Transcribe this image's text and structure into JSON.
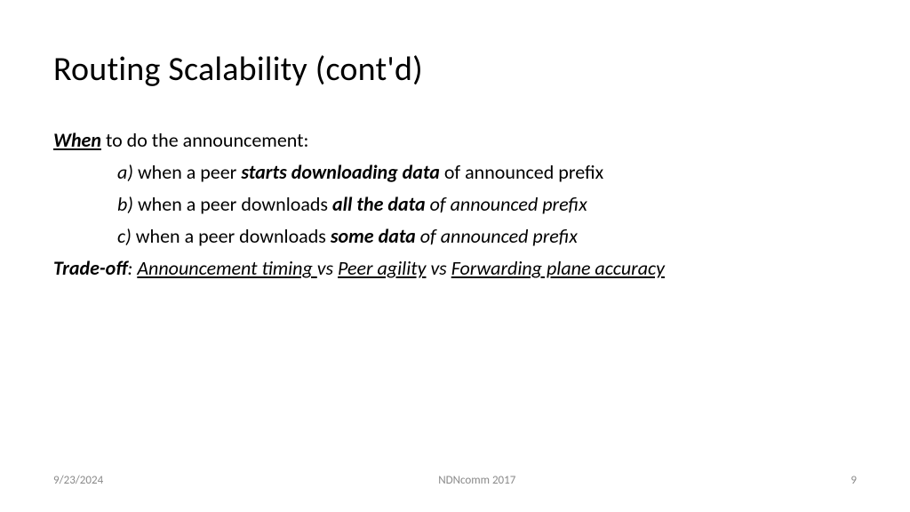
{
  "title": "Routing Scalability (cont'd)",
  "leadWord": "When",
  "leadRest": " to do the announcement:",
  "items": {
    "a": {
      "letter": "a)",
      "pre": " when a peer ",
      "bold": "starts downloading data",
      "post": " of announced prefix"
    },
    "b": {
      "letter": "b)",
      "pre": " when a peer downloads ",
      "bold": "all the data ",
      "post": "of announced prefix"
    },
    "c": {
      "letter": "c)",
      "pre": " when a peer downloads ",
      "bold": "some data ",
      "post": "of announced prefix"
    }
  },
  "tradeoff": {
    "label": "Trade-off",
    "colon": ": ",
    "part1": "Announcement timing ",
    "vs1": "vs",
    "space1": " ",
    "part2": "Peer agility",
    "space2": " ",
    "vs2": "vs",
    "space3": " ",
    "part3": "Forwarding plane accuracy"
  },
  "footer": {
    "date": "9/23/2024",
    "event": "NDNcomm 2017",
    "page": "9"
  }
}
